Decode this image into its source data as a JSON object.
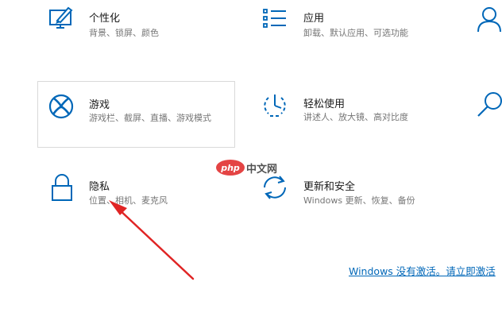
{
  "tiles": {
    "personalization": {
      "title": "个性化",
      "desc": "背景、锁屏、颜色",
      "icon": "personalization-icon"
    },
    "apps": {
      "title": "应用",
      "desc": "卸载、默认应用、可选功能",
      "icon": "apps-icon"
    },
    "gaming": {
      "title": "游戏",
      "desc": "游戏栏、截屏、直播、游戏模式",
      "icon": "xbox-icon"
    },
    "ease_of_access": {
      "title": "轻松使用",
      "desc": "讲述人、放大镜、高对比度",
      "icon": "ease-of-access-icon"
    },
    "privacy": {
      "title": "隐私",
      "desc": "位置、相机、麦克风",
      "icon": "lock-icon"
    },
    "update_security": {
      "title": "更新和安全",
      "desc": "Windows 更新、恢复、备份",
      "icon": "sync-icon"
    },
    "accounts": {
      "icon": "person-icon"
    },
    "search": {
      "icon": "search-icon"
    }
  },
  "activation": {
    "text": "Windows 没有激活。请立即激活"
  },
  "watermark": {
    "badge": "php",
    "text": "中文网"
  },
  "colors": {
    "icon_blue": "#0067b8",
    "link_blue": "#0067b8",
    "annotation_red": "#e02424"
  }
}
